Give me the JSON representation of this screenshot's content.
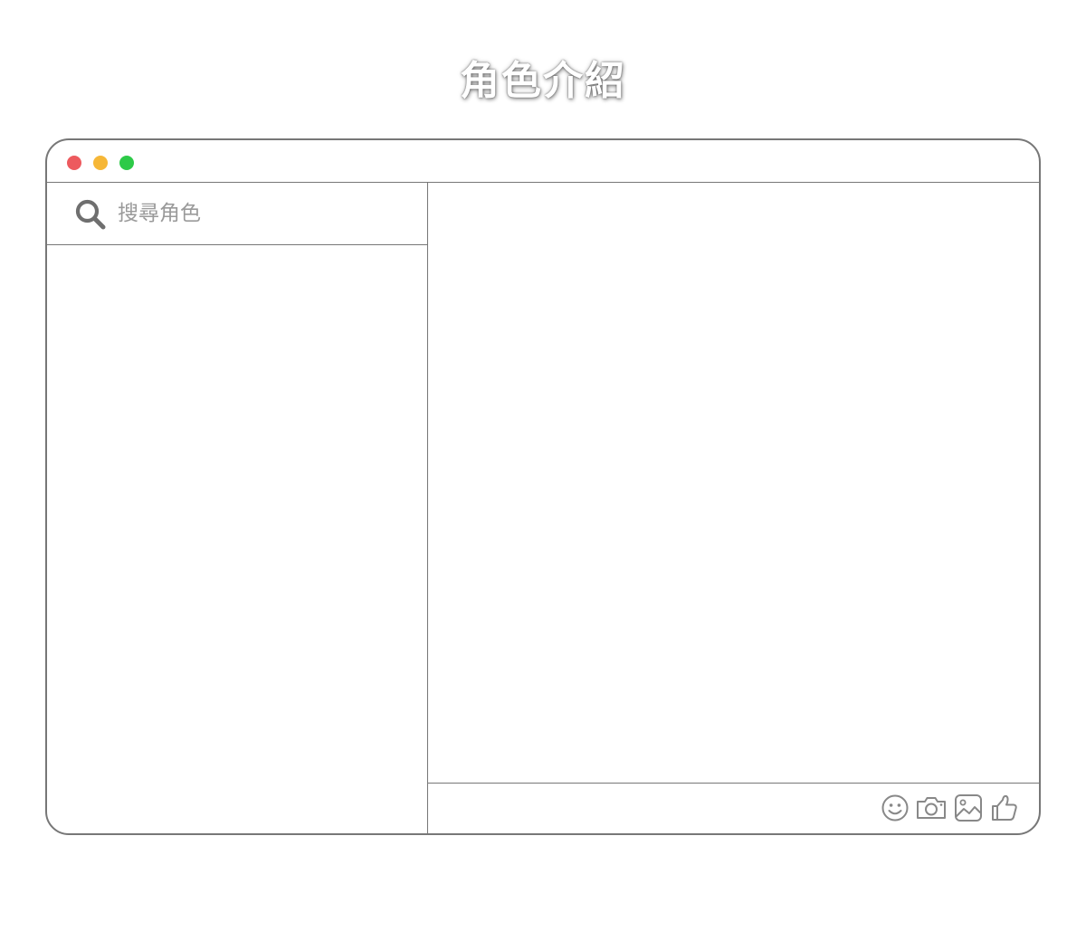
{
  "page": {
    "title": "角色介紹"
  },
  "window": {
    "controls": [
      {
        "name": "close",
        "color": "#ed5a5e"
      },
      {
        "name": "minimize",
        "color": "#f6b737"
      },
      {
        "name": "maximize",
        "color": "#2dca48"
      }
    ]
  },
  "sidebar": {
    "search": {
      "icon": "search-icon",
      "placeholder": "搜尋角色",
      "value": ""
    },
    "items": []
  },
  "content": {
    "messages": [],
    "toolbar": {
      "icons": [
        "smiley-icon",
        "camera-icon",
        "image-icon",
        "thumbs-up-icon"
      ],
      "icon_color": "#888888"
    }
  },
  "colors": {
    "border": "#777777",
    "background": "#ffffff"
  }
}
